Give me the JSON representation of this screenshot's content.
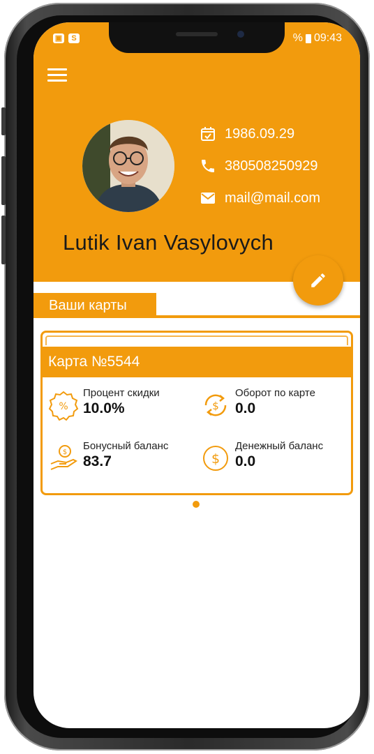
{
  "status_bar": {
    "left_icons": [
      "image-icon",
      "skype-icon"
    ],
    "signal_text": "%",
    "time": "09:43"
  },
  "profile": {
    "birthdate": "1986.09.29",
    "phone": "380508250929",
    "email": "mail@mail.com",
    "name": "Lutik Ivan Vasylovych"
  },
  "cards_section": {
    "tab_label": "Ваши карты"
  },
  "card": {
    "title": "Карта №5544",
    "stats": {
      "discount": {
        "label": "Процент скидки",
        "value": "10.0%"
      },
      "turnover": {
        "label": "Оборот по карте",
        "value": "0.0"
      },
      "bonus": {
        "label": "Бонусный баланс",
        "value": "83.7"
      },
      "money": {
        "label": "Денежный баланс",
        "value": "0.0"
      }
    }
  },
  "colors": {
    "accent": "#f29b0d",
    "text_dark": "#1a1a1a",
    "white": "#ffffff"
  }
}
